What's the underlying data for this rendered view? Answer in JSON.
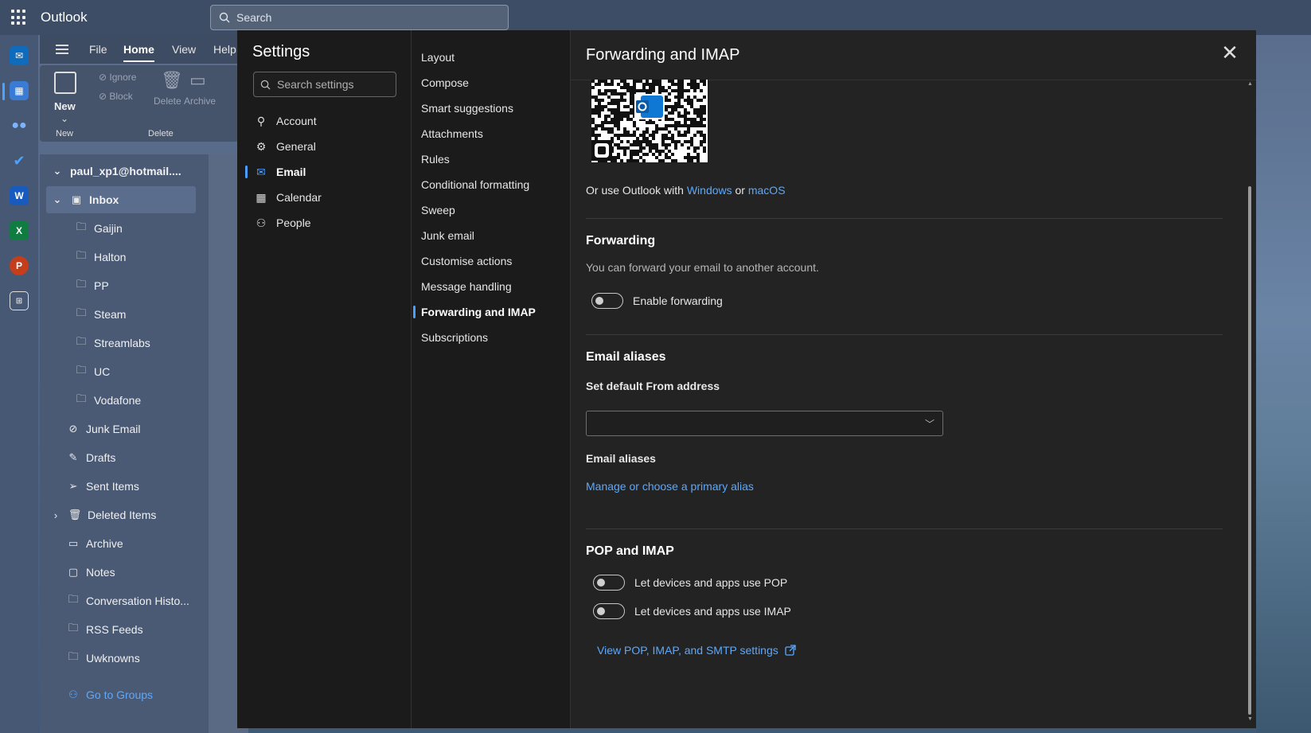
{
  "app": {
    "title": "Outlook"
  },
  "topbar": {
    "search_placeholder": "Search"
  },
  "rail": {
    "icons": [
      "mail-icon",
      "calendar-icon",
      "people-icon",
      "todo-icon",
      "word-icon",
      "excel-icon",
      "powerpoint-icon",
      "apps-icon"
    ],
    "colors": {
      "mail": "#0f6cbd",
      "word": "#185abd",
      "excel": "#107c41",
      "powerpoint": "#c43e1c"
    }
  },
  "ribbon": {
    "tabs": [
      "File",
      "Home",
      "View",
      "Help"
    ],
    "active_tab": "Home",
    "new_label": "New",
    "new_group": "New",
    "ignore_label": "Ignore",
    "block_label": "Block",
    "delete_label": "Delete",
    "archive_label": "Archive",
    "delete_group": "Delete"
  },
  "folders": {
    "account": "paul_xp1@hotmail....",
    "inbox": "Inbox",
    "subfolders": [
      "Gaijin",
      "Halton",
      "PP",
      "Steam",
      "Streamlabs",
      "UC",
      "Vodafone"
    ],
    "junk": "Junk Email",
    "drafts": "Drafts",
    "sent": "Sent Items",
    "deleted": "Deleted Items",
    "archive": "Archive",
    "notes": "Notes",
    "conversation": "Conversation Histo...",
    "rss": "RSS Feeds",
    "unknowns": "Uwknowns",
    "groups": "Go to Groups"
  },
  "settings": {
    "title": "Settings",
    "search_placeholder": "Search settings",
    "categories": [
      "Account",
      "General",
      "Email",
      "Calendar",
      "People"
    ],
    "active_category": "Email",
    "email_subs": [
      "Layout",
      "Compose",
      "Smart suggestions",
      "Attachments",
      "Rules",
      "Conditional formatting",
      "Sweep",
      "Junk email",
      "Customise actions",
      "Message handling",
      "Forwarding and IMAP",
      "Subscriptions"
    ],
    "active_sub": "Forwarding and IMAP"
  },
  "pane": {
    "title": "Forwarding and IMAP",
    "use_outlook_prefix": "Or use Outlook with",
    "windows_link": "Windows",
    "or": "or",
    "macos_link": "macOS",
    "forwarding": {
      "heading": "Forwarding",
      "description": "You can forward your email to another account.",
      "toggle_label": "Enable forwarding",
      "enabled": false
    },
    "aliases": {
      "heading": "Email aliases",
      "default_from_label": "Set default From address",
      "default_from_value": "",
      "aliases_label": "Email aliases",
      "manage_link": "Manage or choose a primary alias"
    },
    "pop_imap": {
      "heading": "POP and IMAP",
      "pop_label": "Let devices and apps use POP",
      "pop_enabled": false,
      "imap_label": "Let devices and apps use IMAP",
      "imap_enabled": false,
      "view_settings_link": "View POP, IMAP, and SMTP settings"
    }
  },
  "colors": {
    "accent": "#4a9eff",
    "link": "#5aa9ff",
    "modal_bg": "#1f1f1f"
  }
}
